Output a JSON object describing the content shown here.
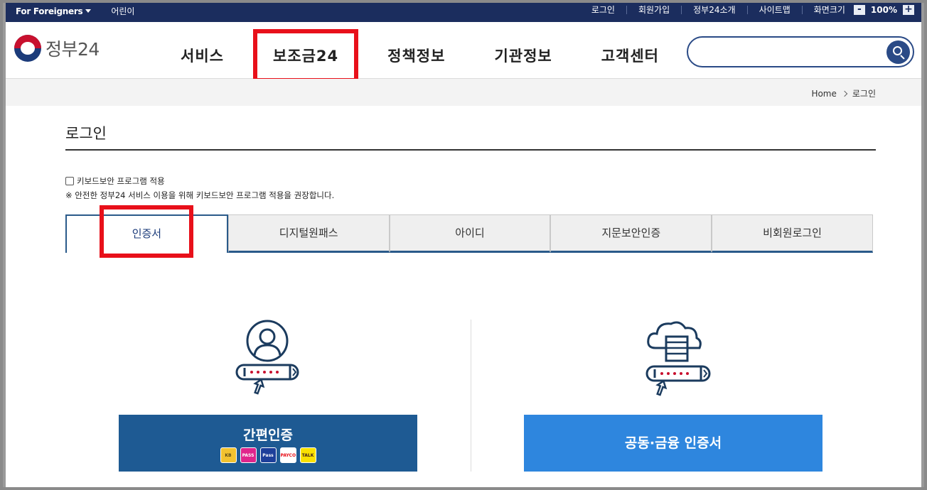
{
  "topbar": {
    "foreigners": "For Foreigners",
    "kids": "어린이",
    "links": [
      "로그인",
      "회원가입",
      "정부24소개",
      "사이트맵"
    ],
    "zoom_label": "화면크기",
    "zoom_minus": "-",
    "zoom_value": "100%",
    "zoom_plus": "+"
  },
  "header": {
    "logo_text": "정부24",
    "menu": [
      "서비스",
      "보조금24",
      "정책정보",
      "기관정보",
      "고객센터"
    ],
    "search_placeholder": ""
  },
  "breadcrumb": {
    "home": "Home",
    "current": "로그인"
  },
  "page": {
    "title": "로그인",
    "keyboard_label": "키보드보안 프로그램 적용",
    "keyboard_note": "※ 안전한 정부24 서비스 이용을 위해 키보드보안 프로그램 적용을 권장합니다.",
    "tabs": [
      "인증서",
      "디지털원패스",
      "아이디",
      "지문보안인증",
      "비회원로그인"
    ],
    "simple_auth_label": "간편인증",
    "simple_auth_providers": [
      {
        "text": "KB",
        "bg": "#f2c230",
        "fg": "#5a4a1a"
      },
      {
        "text": "PASS",
        "bg": "#e0258c",
        "fg": "#ffffff"
      },
      {
        "text": "Pass",
        "bg": "#1d3f9a",
        "fg": "#ffffff"
      },
      {
        "text": "PAYCO",
        "bg": "#ffffff",
        "fg": "#e8101a"
      },
      {
        "text": "TALK",
        "bg": "#fae100",
        "fg": "#3c1e1e"
      }
    ],
    "cert_label": "공동·금융 인증서"
  },
  "colors": {
    "navy": "#1b2d5e",
    "tab_active": "#2a5a8a",
    "btn_simple": "#1e5a93",
    "btn_cert": "#2e86de",
    "highlight": "#e8101a"
  }
}
